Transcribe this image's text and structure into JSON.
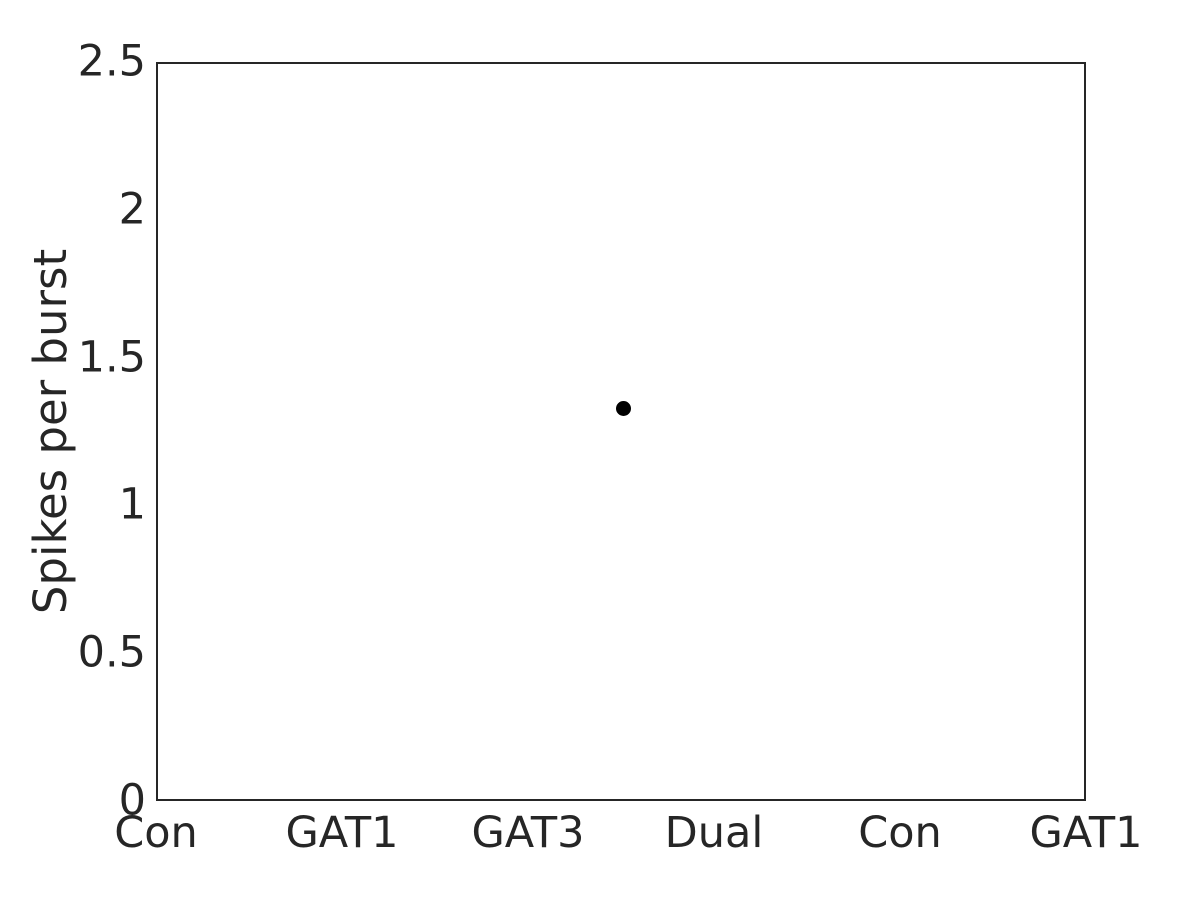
{
  "chart_data": {
    "type": "scatter",
    "title": "",
    "xlabel": "",
    "ylabel": "Spikes per burst",
    "categories": [
      "Con",
      "GAT1",
      "GAT3",
      "Dual",
      "Con",
      "GAT1"
    ],
    "xtick_labels": [
      "Con",
      "GAT1",
      "GAT3",
      "Dual",
      "Con",
      "GAT1"
    ],
    "xtick_positions": [
      1,
      2,
      3,
      4,
      5,
      6
    ],
    "xlim": [
      1,
      6
    ],
    "ylim": [
      0,
      2.5
    ],
    "ytick_labels": [
      "0",
      "0.5",
      "1",
      "1.5",
      "2",
      "2.5"
    ],
    "ytick_values": [
      0,
      0.5,
      1,
      1.5,
      2,
      2.5
    ],
    "grid": false,
    "legend": null,
    "marker": {
      "shape": "circle",
      "color": "#000000",
      "size": 15
    },
    "points": [
      {
        "x": 3.5,
        "y": 1.333,
        "label": ""
      }
    ],
    "axis_color": "#262626",
    "background_color": "#ffffff"
  }
}
